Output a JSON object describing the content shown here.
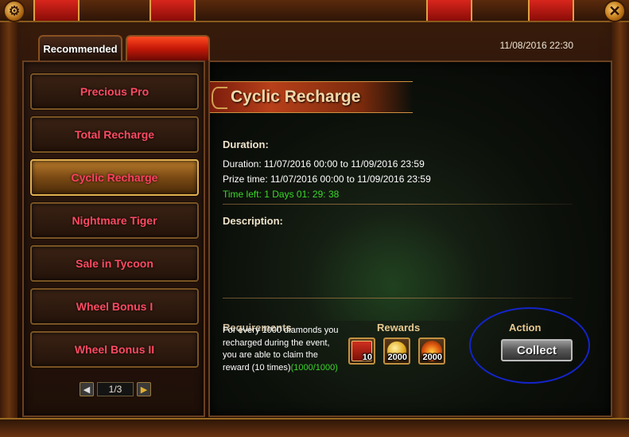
{
  "window": {
    "close_glyph": "✕",
    "settings_glyph": "⚙"
  },
  "tabs": [
    {
      "label": "Recommended"
    },
    {
      "label": ""
    }
  ],
  "header": {
    "timestamp": "11/08/2016 22:30"
  },
  "sidebar": {
    "items": [
      {
        "label": "Precious Pro"
      },
      {
        "label": "Total Recharge"
      },
      {
        "label": "Cyclic Recharge",
        "active": true
      },
      {
        "label": "Nightmare Tiger"
      },
      {
        "label": "Sale in Tycoon"
      },
      {
        "label": "Wheel Bonus I"
      },
      {
        "label": "Wheel Bonus II"
      }
    ],
    "pager": {
      "prev": "◀",
      "next": "▶",
      "page": "1/3"
    }
  },
  "event": {
    "title": "Cyclic Recharge",
    "duration_label": "Duration:",
    "duration": "Duration: 11/07/2016 00:00 to 11/09/2016 23:59",
    "prize_time": "Prize time: 11/07/2016 00:00 to 11/09/2016 23:59",
    "time_left": "Time left: 1 Days  01: 29: 38",
    "description_label": "Description:",
    "requirements_label": "Requirements",
    "requirement_text": "For every 1000 diamonds you recharged during the event, you are able to claim the reward (10 times)",
    "requirement_progress": "(1000/1000)",
    "rewards_label": "Rewards",
    "action_label": "Action",
    "collect_label": "Collect",
    "rewards": [
      {
        "icon": "promo-ticket-icon",
        "qty": "10"
      },
      {
        "icon": "gold-coin-icon",
        "qty": "2000"
      },
      {
        "icon": "flame-gem-icon",
        "qty": "2000"
      }
    ]
  },
  "colors": {
    "menu_text": "#ff4a62",
    "time_left": "#3ad82a",
    "annotation": "#1424c8"
  }
}
